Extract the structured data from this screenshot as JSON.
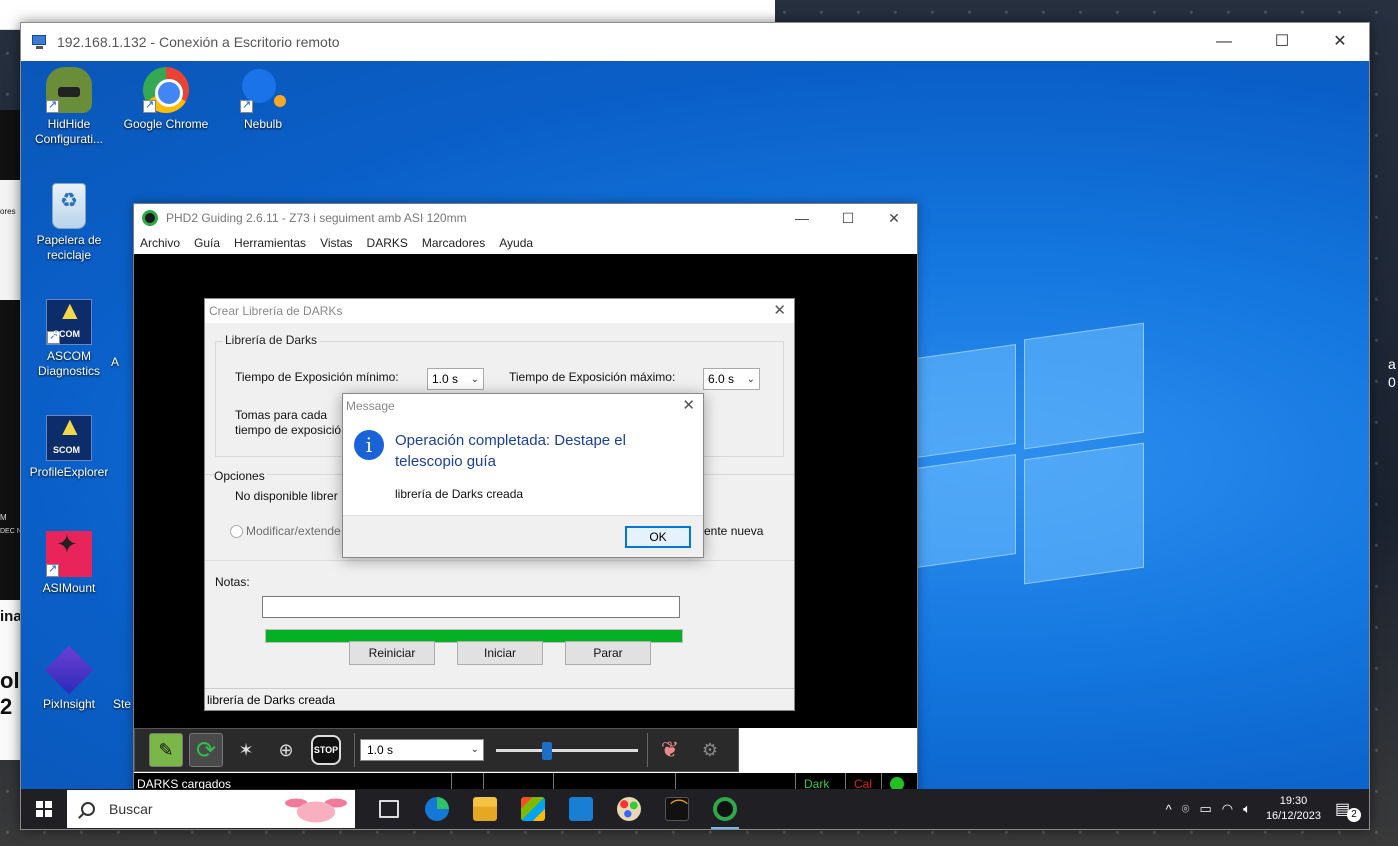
{
  "host": {
    "right_text_lines": [
      "a",
      "0"
    ],
    "left_strip_text": [
      "ores",
      "ina",
      "ol 2",
      "M",
      "DEC N"
    ]
  },
  "rdp": {
    "title": "192.168.1.132 - Conexión a Escritorio remoto",
    "controls": {
      "minimize": "—",
      "maximize": "☐",
      "close": "✕"
    }
  },
  "desktop_icons": [
    {
      "label": "HidHide Configurati...",
      "icon": "hidhide-icon"
    },
    {
      "label": "Google Chrome",
      "icon": "chrome-icon"
    },
    {
      "label": "Nebulb",
      "icon": "nebulb-icon"
    },
    {
      "label": "Papelera de reciclaje",
      "icon": "recycle-bin-icon"
    },
    {
      "label": "ASCOM Diagnostics",
      "icon": "ascom-diagnostics-icon"
    },
    {
      "label": "ProfileExplorer",
      "icon": "profile-explorer-icon"
    },
    {
      "label": "ASIMount",
      "icon": "asimount-icon"
    },
    {
      "label": "PixInsight",
      "icon": "pixinsight-icon"
    }
  ],
  "desktop_partial_labels": [
    "A",
    "Ste"
  ],
  "phd2": {
    "title": "PHD2 Guiding 2.6.11 - Z73 i seguiment amb ASI 120mm",
    "controls": {
      "minimize": "—",
      "maximize": "☐",
      "close": "✕"
    },
    "menu": [
      "Archivo",
      "Guía",
      "Herramientas",
      "Vistas",
      "DARKS",
      "Marcadores",
      "Ayuda"
    ],
    "toolbar": {
      "exposure": "1.0 s",
      "exposure_arrow": "⌄",
      "stop_label": "STOP",
      "gain_fraction": 0.35
    },
    "status": {
      "message": "DARKS cargados",
      "dark": "Dark",
      "cal": "Cal"
    }
  },
  "dark_dialog": {
    "title": "Crear Librería de DARKs",
    "close": "✕",
    "group_label": "Librería de Darks",
    "min_exposure_label": "Tiempo de Exposición mínimo:",
    "min_exposure_value": "1.0 s",
    "max_exposure_label": "Tiempo de Exposición máximo:",
    "max_exposure_value": "6.0 s",
    "frames_label_line1": "Tomas para cada",
    "frames_label_line2": "tiempo de exposició",
    "options_label": "Opciones",
    "not_available": "No disponible librer",
    "modify_extend": "Modificar/extende",
    "new_library_tail": "ente nueva",
    "notes_label": "Notas:",
    "notes_value": "",
    "progress_fraction": 1.0,
    "buttons": {
      "reset": "Reiniciar",
      "start": "Iniciar",
      "stop": "Parar"
    },
    "status_text": "librería de Darks creada"
  },
  "message_box": {
    "title": "Message",
    "close": "✕",
    "icon_glyph": "i",
    "heading": "Operación completada: Destape el telescopio guía",
    "body": "librería de Darks creada",
    "ok": "OK"
  },
  "taskbar": {
    "search_placeholder": "Buscar",
    "apps": [
      "task-view",
      "edge",
      "file-explorer",
      "store",
      "mail",
      "paint",
      "curve-app",
      "phd2"
    ],
    "tray": {
      "chevron": "^",
      "time": "19:30",
      "date": "16/12/2023",
      "notifications_count": "2"
    }
  },
  "colors": {
    "desktop_blue": "#0a5fc7",
    "taskbar": "#1f1f24",
    "progress_green": "#06b025",
    "message_heading": "#1a3f9a",
    "status_dark": "#2ecc40",
    "status_cal": "#e02020"
  }
}
